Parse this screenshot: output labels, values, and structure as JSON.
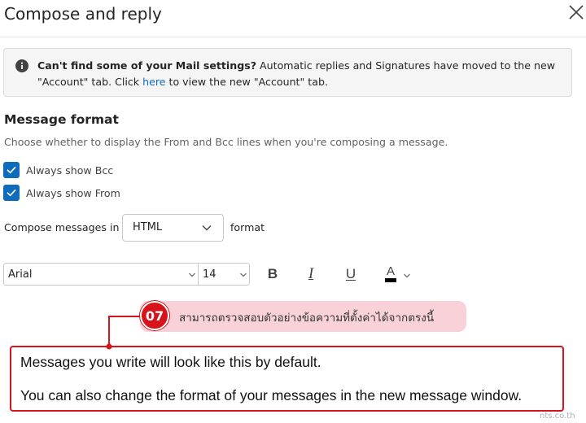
{
  "header": {
    "title": "Compose and reply"
  },
  "info": {
    "bold_text": "Can't find some of your Mail settings?",
    "text_1": " Automatic replies and Signatures have moved to the new \"Account\" tab. Click ",
    "link_text": "here",
    "text_2": " to view the new \"Account\" tab."
  },
  "message_format": {
    "title": "Message format",
    "description": "Choose whether to display the From and Bcc lines when you're composing a message.",
    "checkboxes": [
      {
        "label": "Always show Bcc",
        "checked": true
      },
      {
        "label": "Always show From",
        "checked": true
      }
    ],
    "compose_label": "Compose messages in",
    "format_value": "HTML",
    "format_suffix": "format"
  },
  "toolbar": {
    "font": "Arial",
    "size": "14",
    "bold": "B",
    "italic": "I",
    "underline": "U",
    "font_color_glyph": "A",
    "font_color": "#000000"
  },
  "callout": {
    "number": "07",
    "text": "สามารถตรวจสอบตัวอย่างข้อความที่ตั้งค่าได้จากตรงนี้",
    "color": "#d7131c"
  },
  "preview": {
    "line_1": "Messages you write will look like this by default.",
    "line_2": "You can also change the format of your messages in the new message window."
  },
  "watermark": "nts.co.th",
  "colors": {
    "accent": "#0f6cbd",
    "highlight": "#f9d2d9"
  }
}
